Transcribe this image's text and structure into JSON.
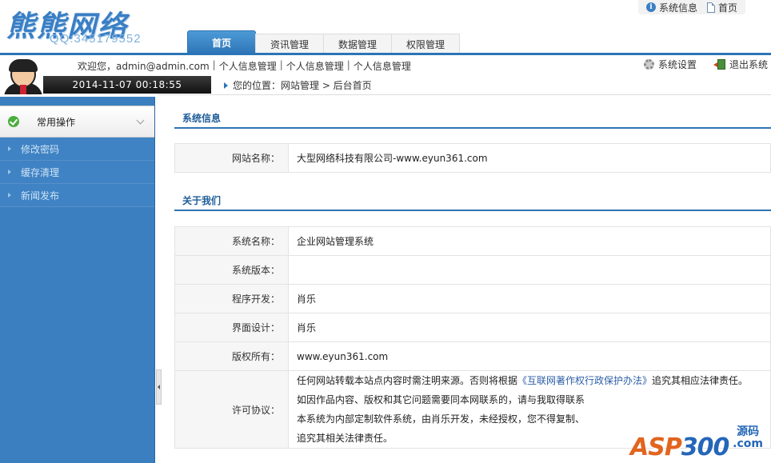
{
  "header": {
    "logo_title": "熊熊网络",
    "logo_qq": "QQ:345179552",
    "top_links": [
      {
        "label": "系统信息",
        "icon": "info-icon"
      },
      {
        "label": "首页",
        "icon": "page-icon"
      }
    ],
    "tabs": [
      {
        "label": "首页",
        "active": true
      },
      {
        "label": "资讯管理",
        "active": false
      },
      {
        "label": "数据管理",
        "active": false
      },
      {
        "label": "权限管理",
        "active": false
      }
    ]
  },
  "subheader": {
    "welcome": "欢迎您，admin@admin.com",
    "links": [
      "个人信息管理",
      "个人信息管理",
      "个人信息管理"
    ],
    "separator": "|",
    "datetime": "2014-11-07 00:18:55",
    "breadcrumb": "您的位置：网站管理 > 后台首页",
    "tools": [
      {
        "label": "系统设置",
        "icon": "gear-icon"
      },
      {
        "label": "退出系统",
        "icon": "exit-icon"
      }
    ]
  },
  "sidebar": {
    "head_label": "常用操作",
    "items": [
      {
        "label": "修改密码"
      },
      {
        "label": "缓存清理"
      },
      {
        "label": "新闻发布"
      }
    ]
  },
  "main": {
    "sections": [
      {
        "title": "系统信息",
        "rows": [
          {
            "label": "网站名称：",
            "value": "大型网络科技有限公司-www.eyun361.com"
          }
        ]
      },
      {
        "title": "关于我们",
        "rows": [
          {
            "label": "系统名称：",
            "value": "企业网站管理系统"
          },
          {
            "label": "系统版本：",
            "value": ""
          },
          {
            "label": "程序开发：",
            "value": "肖乐"
          },
          {
            "label": "界面设计：",
            "value": "肖乐"
          },
          {
            "label": "版权所有：",
            "value": "www.eyun361.com"
          }
        ]
      }
    ],
    "license": {
      "label": "许可协议：",
      "line1_before": "任何网站转载本站点内容时需注明来源。否则将根据",
      "line1_link": "《互联网著作权行政保护办法》",
      "line1_after": "追究其相应法律责任。",
      "line2": "如因作品内容、版权和其它问题需要同本网联系的，请与我取得联系",
      "line3": "本系统为内部定制软件系统，由肖乐开发，未经授权，您不得复制、",
      "line4": "追究其相关法律责任。"
    }
  },
  "watermark": {
    "text_a": "ASP",
    "text_b": "300",
    "small_1": "源码",
    "small_2": ".com"
  },
  "colors": {
    "accent": "#2d74b6",
    "sidebar": "#3b7fc0",
    "watermark_orange": "#e2641e"
  }
}
